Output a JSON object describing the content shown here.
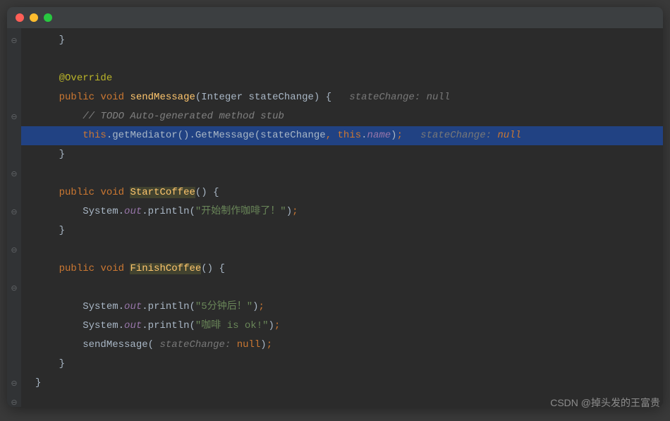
{
  "watermark": "CSDN @掉头发的王富贵",
  "gutter": [
    "⊖",
    "",
    "",
    "",
    "⊖",
    "",
    "",
    "⊖",
    "",
    "⊖",
    "",
    "⊖",
    "",
    "⊖",
    "",
    "",
    "",
    "",
    "⊖",
    "⊖"
  ],
  "code": {
    "brace_close": "}",
    "override": "@Override",
    "public": "public",
    "void": "void",
    "sendMessage": "sendMessage",
    "Integer": "Integer",
    "stateChange_param": "stateChange",
    "open_brace": "{",
    "hint1_label": "stateChange:",
    "hint1_val": "null",
    "todo": "// TODO Auto-generated method stub",
    "this": "this",
    "getMediator": "getMediator",
    "GetMessage": "GetMessage",
    "stateChange_arg": "stateChange",
    "name": "name",
    "semicolon": ";",
    "hint2_label": "stateChange: ",
    "hint2_val": "null",
    "StartCoffee": "StartCoffee",
    "System": "System",
    "out": "out",
    "println": "println",
    "str_start": "\"开始制作咖啡了！\"",
    "FinishCoffee": "FinishCoffee",
    "str_5min": "\"5分钟后！\"",
    "str_ok": "\"咖啡 is ok!\"",
    "sendMessage_call": "sendMessage",
    "hint3_label": "stateChange:",
    "null_kw": "null"
  }
}
